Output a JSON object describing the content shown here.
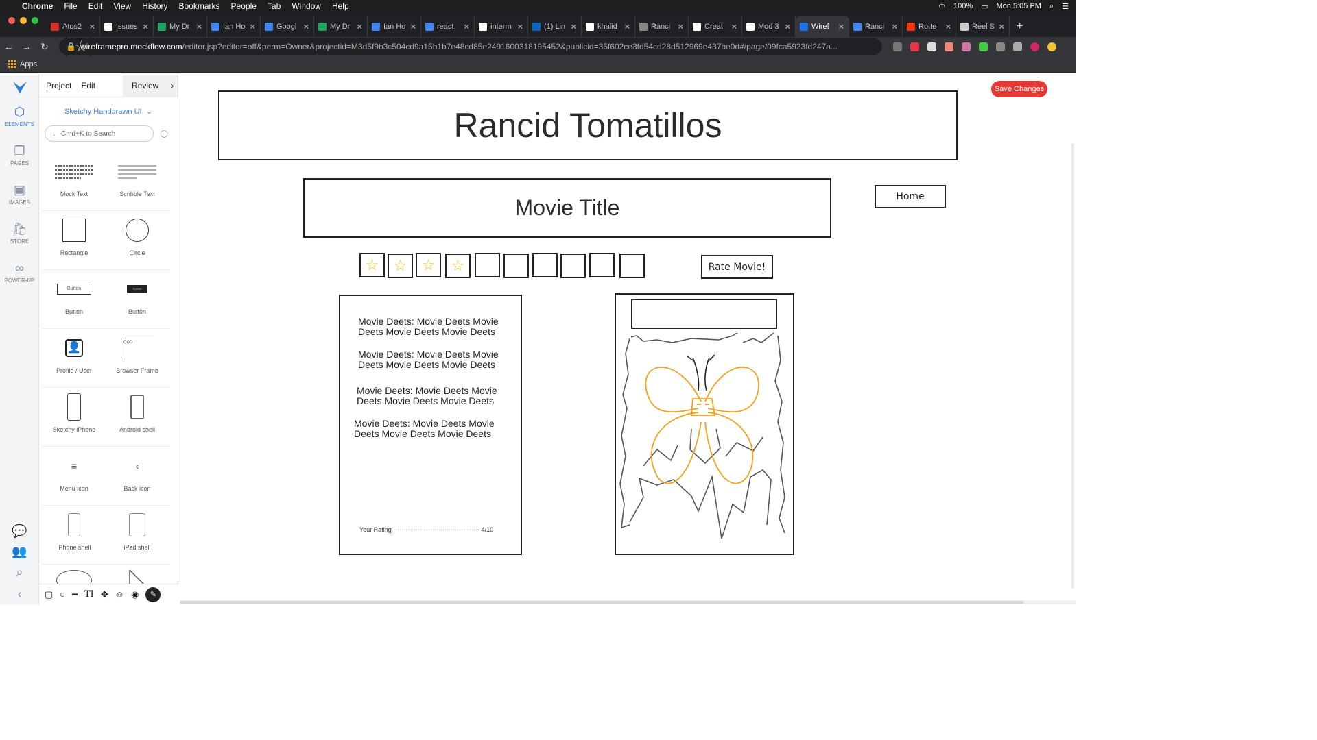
{
  "menubar": {
    "app": "Chrome",
    "items": [
      "File",
      "Edit",
      "View",
      "History",
      "Bookmarks",
      "People",
      "Tab",
      "Window",
      "Help"
    ],
    "battery": "100%",
    "clock": "Mon 5:05 PM"
  },
  "tabs": [
    {
      "label": "Atos2",
      "color": "#d93025"
    },
    {
      "label": "Issues",
      "color": "#ffffff"
    },
    {
      "label": "My Dr",
      "color": "#1fa463"
    },
    {
      "label": "Ian Ho",
      "color": "#4285f4"
    },
    {
      "label": "Googl",
      "color": "#4285f4"
    },
    {
      "label": "My Dr",
      "color": "#1fa463"
    },
    {
      "label": "Ian Ho",
      "color": "#4285f4"
    },
    {
      "label": "react",
      "color": "#4285f4"
    },
    {
      "label": "interm",
      "color": "#ffffff"
    },
    {
      "label": "(1) Lin",
      "color": "#0a66c2"
    },
    {
      "label": "khalid",
      "color": "#ffffff"
    },
    {
      "label": "Ranci",
      "color": "#888888"
    },
    {
      "label": "Creat",
      "color": "#ffffff"
    },
    {
      "label": "Mod 3",
      "color": "#ffffff"
    },
    {
      "label": "Wiref",
      "color": "#1a73e8",
      "active": true
    },
    {
      "label": "Ranci",
      "color": "#4285f4"
    },
    {
      "label": "Rotte",
      "color": "#fa320a"
    },
    {
      "label": "Reel S",
      "color": "#cccccc"
    }
  ],
  "address": {
    "host": "wireframepro.mockflow.com",
    "path": "/editor.jsp?editor=off&perm=Owner&projectid=M3d5f9b3c504cd9a15b1b7e48cd85e2491600318195452&publicid=35f602ce3fd54cd28d512969e437be0d#/page/09fca5923fd247a..."
  },
  "bookmarks": {
    "apps": "Apps"
  },
  "rail": [
    {
      "label": "ELEMENTS",
      "icon": "cube-icon",
      "glyph": "⬡",
      "active": true
    },
    {
      "label": "PAGES",
      "icon": "pages-icon",
      "glyph": "❐"
    },
    {
      "label": "IMAGES",
      "icon": "images-icon",
      "glyph": "▣"
    },
    {
      "label": "STORE",
      "icon": "store-icon",
      "glyph": "🛍"
    },
    {
      "label": "POWER-UP",
      "icon": "infinity-icon",
      "glyph": "∞"
    }
  ],
  "panel": {
    "project": "Project",
    "edit": "Edit",
    "review": "Review",
    "library": "Sketchy Handdrawn UI",
    "search_placeholder": "Cmd+K to Search",
    "elements": [
      "Mock Text",
      "Scribble Text",
      "Rectangle",
      "Circle",
      "Button",
      "Button",
      "Profile / User",
      "Browser Frame",
      "Sketchy iPhone",
      "Android shell",
      "Menu icon",
      "Back icon",
      "iPhone shell",
      "iPad shell"
    ],
    "thumb_button_text": "Button",
    "thumb_button2_text": "Submit"
  },
  "canvas": {
    "save_label": "Save Changes",
    "site_title": "Rancid Tomatillos",
    "movie_title": "Movie Title",
    "home_label": "Home",
    "rate_label": "Rate Movie!",
    "stars_total": 10,
    "stars_filled": 4,
    "details": [
      "Movie Deets: Movie Deets Movie Deets Movie Deets Movie Deets",
      "Movie Deets: Movie Deets Movie Deets Movie Deets Movie Deets",
      "Movie Deets: Movie Deets Movie Deets Movie Deets Movie Deets",
      "Movie Deets: Movie Deets Movie Deets Movie Deets Movie Deets"
    ],
    "rating_label": "Your Rating",
    "rating_value": "4/10",
    "accent": "#e53935",
    "flower_color": "#f5a01a"
  }
}
